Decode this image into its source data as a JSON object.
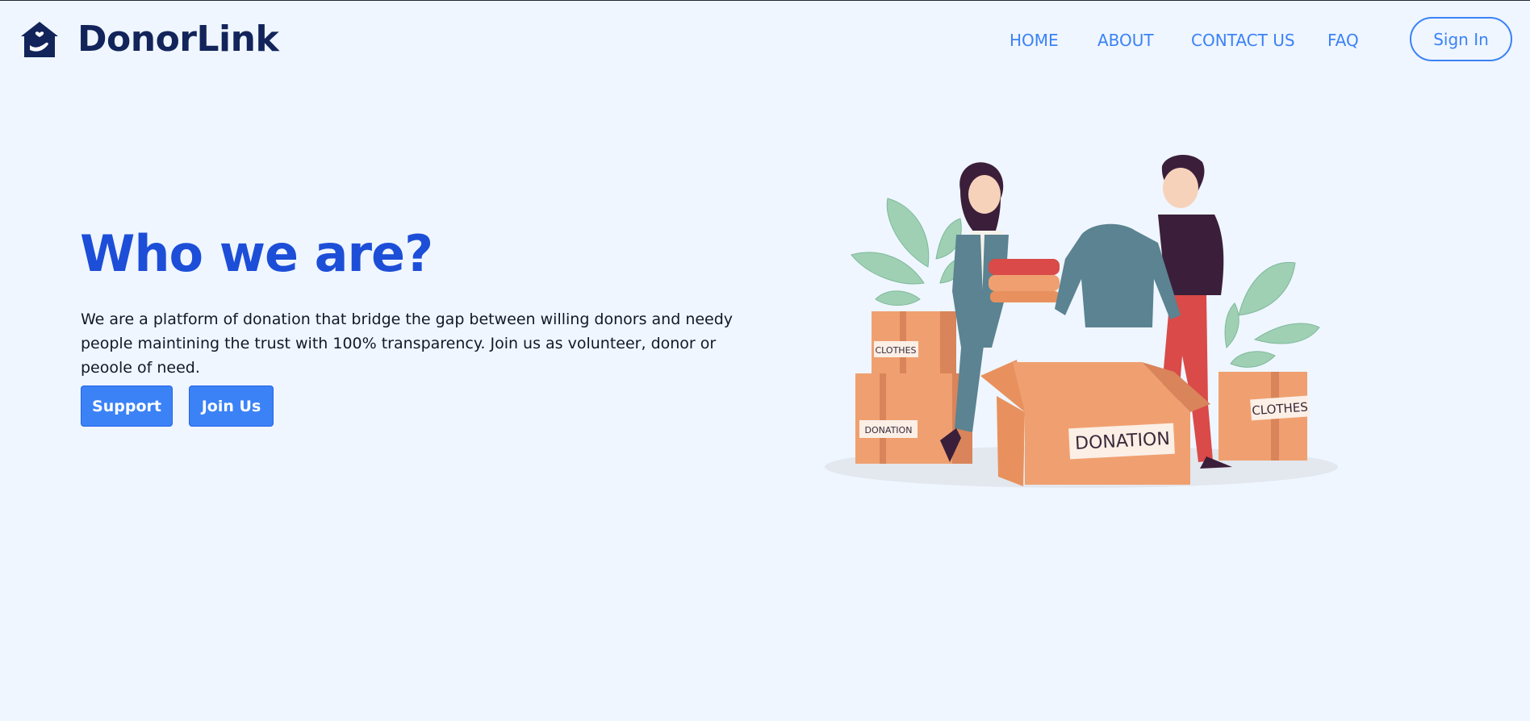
{
  "brand": {
    "name": "DonorLink",
    "logo_icon": "house-heart-hand-icon",
    "color": "#12245a"
  },
  "nav": {
    "items": [
      {
        "label": "HOME"
      },
      {
        "label": "ABOUT"
      },
      {
        "label": "CONTACT US"
      },
      {
        "label": "FAQ"
      }
    ],
    "sign_in_label": "Sign In",
    "link_color": "#3b82f6"
  },
  "hero": {
    "title": "Who we are?",
    "description": "We are a platform of donation that bridge the gap between willing donors and needy people maintining the trust with 100% transparency. Join us as volunteer, donor or peoole of need.",
    "support_label": "Support",
    "join_label": "Join Us",
    "title_color": "#1d4ed8",
    "button_color": "#3b82f6"
  },
  "illustration": {
    "box_labels": {
      "clothes_left": "CLOTHES",
      "donation_left": "DONATION",
      "donation_center": "DONATION",
      "clothes_right": "CLOTHES"
    },
    "box_color": "#f0a070",
    "leaf_color": "#9fd0b4"
  },
  "page": {
    "background": "#eff6ff"
  }
}
